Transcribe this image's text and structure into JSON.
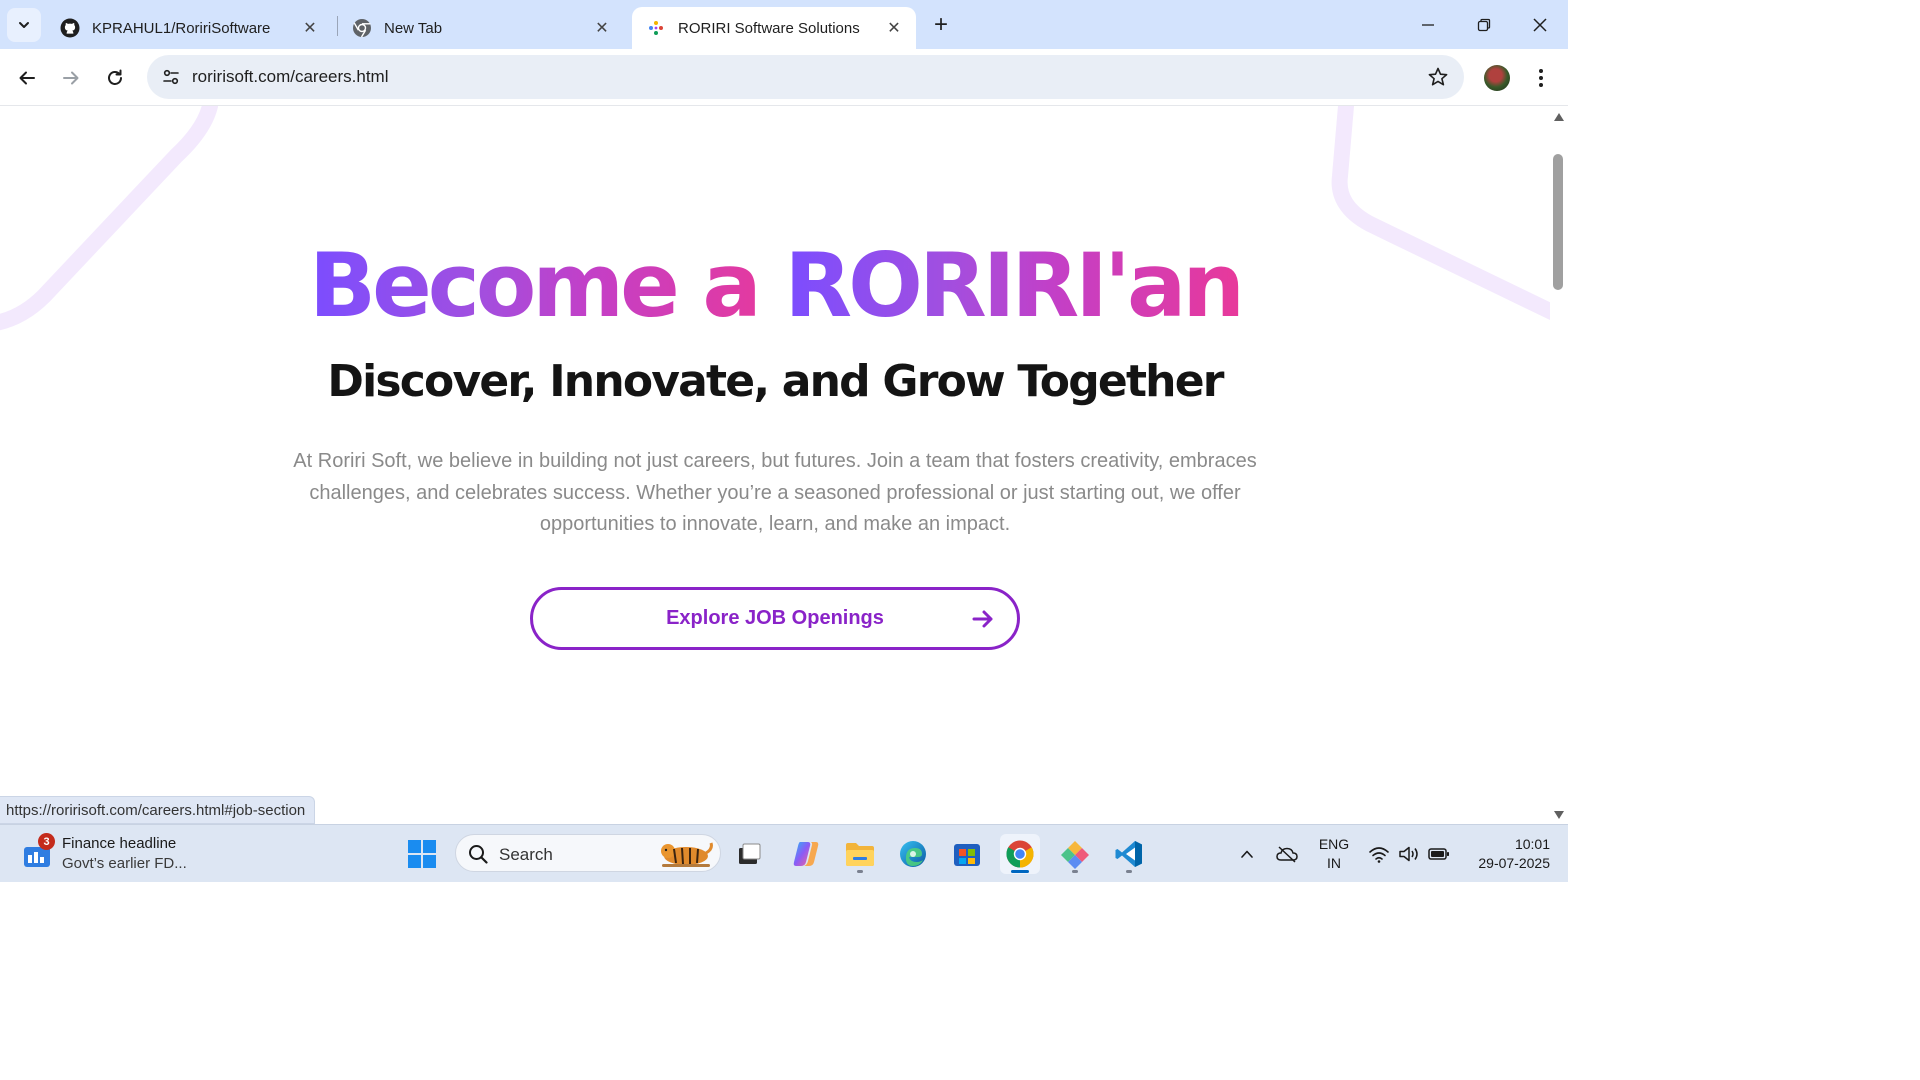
{
  "browser": {
    "tabs": [
      {
        "title": "KPRAHUL1/RoririSoftware",
        "favicon": "github-icon"
      },
      {
        "title": "New Tab",
        "favicon": "chrome-icon"
      },
      {
        "title": "RORIRI Software Solutions",
        "favicon": "roriri-icon",
        "active": true
      }
    ],
    "url": "roririsoft.com/careers.html",
    "status_url": "https://roririsoft.com/careers.html#job-section"
  },
  "page": {
    "title_part1": "Become a ",
    "title_part2": "RORIRI'an",
    "subtitle": "Discover, Innovate, and Grow Together",
    "body": "At Roriri Soft, we believe in building not just careers, but futures. Join a team that fosters creativity, embraces challenges, and celebrates success. Whether you’re a seasoned professional or just starting out, we offer opportunities to innovate, learn, and make an impact.",
    "cta_label": "Explore JOB Openings",
    "colors": {
      "gradient_start": "#7b4dff",
      "gradient_end": "#e8399a",
      "cta": "#8a23c8"
    }
  },
  "taskbar": {
    "widget": {
      "badge": "3",
      "title": "Finance headline",
      "subtitle": "Govt’s earlier FD..."
    },
    "search_label": "Search",
    "apps": [
      "start-icon",
      "task-view-icon",
      "copilot-icon",
      "file-explorer-icon",
      "edge-icon",
      "store-icon",
      "chrome-icon",
      "color-app-icon",
      "vscode-icon"
    ],
    "lang_line1": "ENG",
    "lang_line2": "IN",
    "time": "10:01",
    "date": "29-07-2025"
  }
}
